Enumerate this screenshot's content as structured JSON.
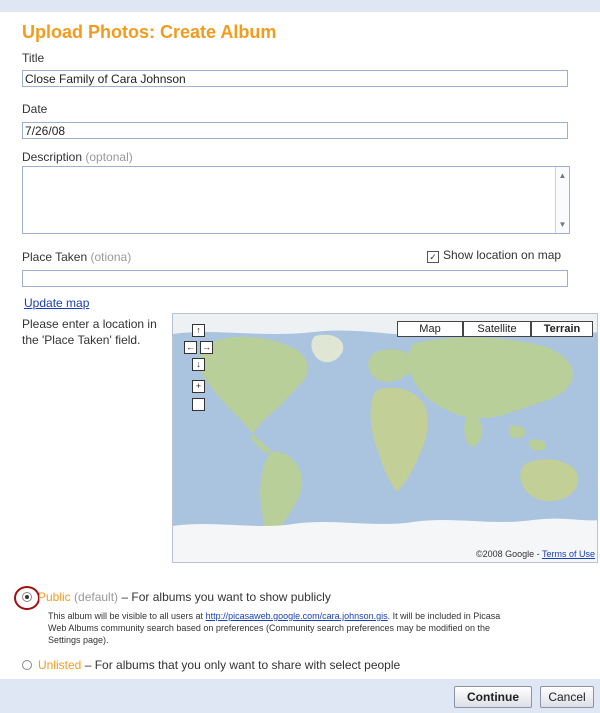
{
  "page": {
    "title": "Upload Photos: Create Album"
  },
  "form": {
    "title_label": "Title",
    "title_value": "Close Family of Cara Johnson",
    "date_label": "Date",
    "date_value": "7/26/08",
    "description_label": "Description",
    "description_optional": "(optonal)",
    "description_value": "",
    "place_label": "Place Taken",
    "place_optional": "(otiona)",
    "place_value": "",
    "show_location_label": "Show location on map",
    "show_location_checked": true,
    "update_map_link": "Update map",
    "hint_text": "Please enter a location in the 'Place Taken' field."
  },
  "map": {
    "type_buttons": [
      {
        "label": "Map",
        "selected": false
      },
      {
        "label": "Satellite",
        "selected": false
      },
      {
        "label": "Terrain",
        "selected": true
      }
    ],
    "controls": {
      "pan_up": "↑",
      "pan_left": "←",
      "pan_right": "→",
      "pan_down": "↓",
      "zoom_in": "+",
      "zoom_out": ""
    },
    "copyright": "©2008 Google - ",
    "terms_link": "Terms of Use",
    "colors": {
      "water": "#aac4e0",
      "land": "#b9cf9a",
      "ice": "#f4f6f8"
    }
  },
  "visibility": {
    "public_label": "Public",
    "public_default": "(default)",
    "public_rest": " – For albums you want to show publicly",
    "public_selected": true,
    "public_desc_prefix": "This album will be visible to all users at ",
    "public_desc_link": "http://picasaweb.google.com/cara.johnson.gis",
    "public_desc_suffix": ". It will be included in Picasa Web Albums community search based on preferences (Community search preferences may be modified on the Settings page).",
    "unlisted_label": "Unlisted",
    "unlisted_rest": " – For albums that you only want to share with select people",
    "unlisted_selected": false
  },
  "buttons": {
    "continue": "Continue",
    "cancel": "Cancel"
  },
  "colors": {
    "title_orange": "#f49b1b",
    "frame_blue": "#dfe6f4",
    "link_blue": "#1a3fb8",
    "highlight_red": "#a01010"
  }
}
